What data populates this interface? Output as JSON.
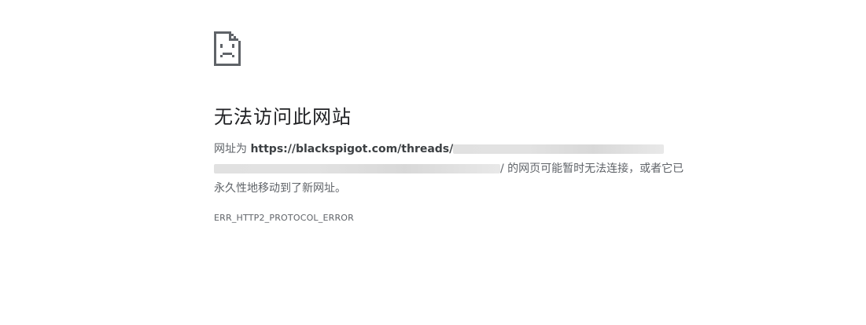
{
  "icon": "sad-page-icon",
  "title": "无法访问此网站",
  "summary": {
    "prefix": "网址为 ",
    "url": "https://blackspigot.com/threads/",
    "suffix": "/ 的网页可能暂时无法连接，或者它已永久性地移动到了新网址。"
  },
  "error_code": "ERR_HTTP2_PROTOCOL_ERROR"
}
